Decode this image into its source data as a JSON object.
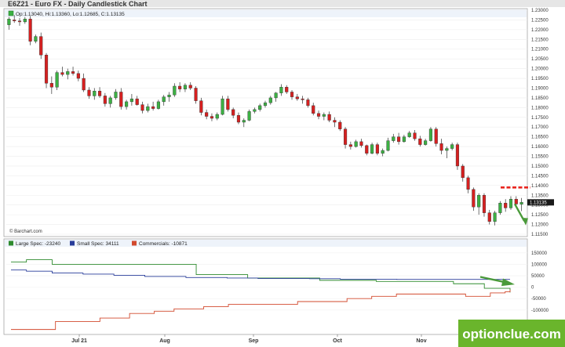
{
  "chart_data": [
    {
      "type": "candlestick",
      "title": "E6Z21 - Euro FX - Daily Candlestick Chart",
      "ohlc_label": "Op:1.13040, Hi:1.13360, Lo:1.12685, C:1.13135",
      "last_price_badge": "1.13135",
      "credit": "© Barchart.com",
      "y_ticks": [
        "1.23000",
        "1.22500",
        "1.22000",
        "1.21500",
        "1.21000",
        "1.20500",
        "1.20000",
        "1.19500",
        "1.19000",
        "1.18500",
        "1.18000",
        "1.17500",
        "1.17000",
        "1.16500",
        "1.16000",
        "1.15500",
        "1.15000",
        "1.14500",
        "1.14000",
        "1.13500",
        "1.13000",
        "1.12500",
        "1.12000",
        "1.11500"
      ],
      "ylim": [
        1.115,
        1.23
      ],
      "x_tick_labels": [
        "Jul 21",
        "Aug",
        "Sep",
        "Oct",
        "Nov"
      ],
      "annotations": {
        "support_level": 1.139,
        "support_color": "#e8251f",
        "arrow_color": "#4a9a3a"
      },
      "colors": {
        "up": "#3cb043",
        "down": "#d62020"
      },
      "candles": [
        [
          1.2225,
          1.2265,
          1.22,
          1.2255
        ],
        [
          1.225,
          1.2275,
          1.2235,
          1.2245
        ],
        [
          1.2245,
          1.226,
          1.222,
          1.224
        ],
        [
          1.224,
          1.2265,
          1.223,
          1.2255
        ],
        [
          1.2255,
          1.227,
          1.212,
          1.214
        ],
        [
          1.214,
          1.2175,
          1.213,
          1.2165
        ],
        [
          1.2165,
          1.2185,
          1.205,
          1.207
        ],
        [
          1.207,
          1.208,
          1.19,
          1.1925
        ],
        [
          1.1925,
          1.196,
          1.187,
          1.1905
        ],
        [
          1.1905,
          1.199,
          1.189,
          1.198
        ],
        [
          1.198,
          1.201,
          1.196,
          1.197
        ],
        [
          1.197,
          1.2,
          1.1945,
          1.1985
        ],
        [
          1.1985,
          1.201,
          1.1965,
          1.1975
        ],
        [
          1.1975,
          1.199,
          1.1935,
          1.195
        ],
        [
          1.195,
          1.1975,
          1.188,
          1.189
        ],
        [
          1.189,
          1.1905,
          1.1845,
          1.186
        ],
        [
          1.186,
          1.19,
          1.184,
          1.1885
        ],
        [
          1.1885,
          1.1905,
          1.185,
          1.186
        ],
        [
          1.186,
          1.1875,
          1.1805,
          1.182
        ],
        [
          1.182,
          1.186,
          1.18,
          1.185
        ],
        [
          1.185,
          1.1895,
          1.184,
          1.188
        ],
        [
          1.188,
          1.19,
          1.179,
          1.1805
        ],
        [
          1.1805,
          1.184,
          1.179,
          1.183
        ],
        [
          1.183,
          1.187,
          1.181,
          1.1845
        ],
        [
          1.1845,
          1.186,
          1.181,
          1.1815
        ],
        [
          1.1815,
          1.183,
          1.177,
          1.1785
        ],
        [
          1.1785,
          1.182,
          1.1775,
          1.1805
        ],
        [
          1.1805,
          1.183,
          1.1785,
          1.1795
        ],
        [
          1.1795,
          1.184,
          1.179,
          1.183
        ],
        [
          1.183,
          1.1865,
          1.181,
          1.1855
        ],
        [
          1.1855,
          1.188,
          1.183,
          1.1865
        ],
        [
          1.1865,
          1.1925,
          1.1855,
          1.191
        ],
        [
          1.191,
          1.193,
          1.188,
          1.1895
        ],
        [
          1.1895,
          1.1925,
          1.188,
          1.1915
        ],
        [
          1.1915,
          1.193,
          1.189,
          1.19
        ],
        [
          1.19,
          1.191,
          1.182,
          1.1835
        ],
        [
          1.1835,
          1.185,
          1.176,
          1.1775
        ],
        [
          1.1775,
          1.179,
          1.174,
          1.1755
        ],
        [
          1.1755,
          1.177,
          1.173,
          1.1745
        ],
        [
          1.1745,
          1.1775,
          1.1735,
          1.1765
        ],
        [
          1.1765,
          1.186,
          1.176,
          1.1845
        ],
        [
          1.1845,
          1.186,
          1.178,
          1.179
        ],
        [
          1.179,
          1.18,
          1.1745,
          1.176
        ],
        [
          1.176,
          1.1775,
          1.1715,
          1.1725
        ],
        [
          1.1725,
          1.1745,
          1.17,
          1.1735
        ],
        [
          1.1735,
          1.179,
          1.173,
          1.178
        ],
        [
          1.178,
          1.18,
          1.177,
          1.179
        ],
        [
          1.179,
          1.182,
          1.178,
          1.181
        ],
        [
          1.181,
          1.1835,
          1.18,
          1.1825
        ],
        [
          1.1825,
          1.186,
          1.1815,
          1.185
        ],
        [
          1.185,
          1.188,
          1.183,
          1.1875
        ],
        [
          1.1875,
          1.192,
          1.186,
          1.1905
        ],
        [
          1.1905,
          1.1915,
          1.187,
          1.188
        ],
        [
          1.188,
          1.189,
          1.184,
          1.1855
        ],
        [
          1.1855,
          1.187,
          1.1835,
          1.1845
        ],
        [
          1.1845,
          1.186,
          1.182,
          1.184
        ],
        [
          1.184,
          1.185,
          1.18,
          1.181
        ],
        [
          1.181,
          1.1825,
          1.176,
          1.177
        ],
        [
          1.177,
          1.1785,
          1.174,
          1.1755
        ],
        [
          1.1755,
          1.1775,
          1.1735,
          1.1765
        ],
        [
          1.1765,
          1.178,
          1.1725,
          1.1735
        ],
        [
          1.1735,
          1.175,
          1.17,
          1.1725
        ],
        [
          1.1725,
          1.1735,
          1.168,
          1.169
        ],
        [
          1.169,
          1.17,
          1.159,
          1.161
        ],
        [
          1.161,
          1.1625,
          1.1585,
          1.16
        ],
        [
          1.16,
          1.1635,
          1.1595,
          1.1625
        ],
        [
          1.1625,
          1.164,
          1.1595,
          1.1605
        ],
        [
          1.1605,
          1.161,
          1.1555,
          1.1565
        ],
        [
          1.1565,
          1.162,
          1.156,
          1.161
        ],
        [
          1.161,
          1.162,
          1.1555,
          1.1565
        ],
        [
          1.1565,
          1.159,
          1.155,
          1.158
        ],
        [
          1.158,
          1.1645,
          1.1575,
          1.163
        ],
        [
          1.163,
          1.1665,
          1.162,
          1.165
        ],
        [
          1.165,
          1.167,
          1.161,
          1.1625
        ],
        [
          1.1625,
          1.166,
          1.162,
          1.165
        ],
        [
          1.165,
          1.168,
          1.1645,
          1.167
        ],
        [
          1.167,
          1.1685,
          1.163,
          1.164
        ],
        [
          1.164,
          1.1655,
          1.16,
          1.161
        ],
        [
          1.161,
          1.164,
          1.1605,
          1.163
        ],
        [
          1.163,
          1.17,
          1.1625,
          1.169
        ],
        [
          1.169,
          1.17,
          1.16,
          1.1615
        ],
        [
          1.1615,
          1.164,
          1.156,
          1.158
        ],
        [
          1.158,
          1.16,
          1.154,
          1.159
        ],
        [
          1.159,
          1.162,
          1.158,
          1.161
        ],
        [
          1.161,
          1.162,
          1.148,
          1.15
        ],
        [
          1.15,
          1.151,
          1.142,
          1.144
        ],
        [
          1.144,
          1.145,
          1.136,
          1.138
        ],
        [
          1.138,
          1.139,
          1.127,
          1.129
        ],
        [
          1.129,
          1.136,
          1.125,
          1.135
        ],
        [
          1.135,
          1.136,
          1.124,
          1.126
        ],
        [
          1.126,
          1.1275,
          1.12,
          1.1215
        ],
        [
          1.1215,
          1.127,
          1.1195,
          1.126
        ],
        [
          1.126,
          1.132,
          1.125,
          1.131
        ],
        [
          1.131,
          1.133,
          1.1265,
          1.1285
        ],
        [
          1.1285,
          1.1345,
          1.1275,
          1.133
        ],
        [
          1.133,
          1.1345,
          1.129,
          1.1305
        ],
        [
          1.1304,
          1.1336,
          1.12685,
          1.13135
        ]
      ],
      "lower_panel": {
        "type": "line",
        "y_ticks": [
          "150000",
          "100000",
          "50000",
          "0",
          "-50000",
          "-100000"
        ],
        "ylim": [
          -200000,
          170000
        ],
        "series": [
          {
            "name": "Large Spec: -23240",
            "color": "#2e8b2e",
            "values": [
              110000,
              110000,
              110000,
              120000,
              120000,
              120000,
              120000,
              120000,
              100000,
              100000,
              100000,
              100000,
              100000,
              100000,
              100000,
              100000,
              100000,
              100000,
              100000,
              100000,
              100000,
              100000,
              100000,
              100000,
              100000,
              100000,
              100000,
              100000,
              100000,
              100000,
              100000,
              100000,
              100000,
              100000,
              100000,
              100000,
              55000,
              55000,
              55000,
              55000,
              55000,
              55000,
              55000,
              55000,
              55000,
              55000,
              40000,
              40000,
              40000,
              40000,
              40000,
              40000,
              40000,
              40000,
              40000,
              40000,
              40000,
              40000,
              40000,
              40000,
              30000,
              30000,
              30000,
              30000,
              30000,
              30000,
              30000,
              30000,
              30000,
              30000,
              30000,
              25000,
              25000,
              25000,
              25000,
              25000,
              25000,
              25000,
              25000,
              25000,
              25000,
              25000,
              25000,
              25000,
              25000,
              25000,
              15000,
              15000,
              15000,
              15000,
              15000,
              15000,
              -5000,
              -5000,
              -5000,
              -5000,
              -5000,
              -23240
            ]
          },
          {
            "name": "Small Spec: 34111",
            "color": "#283c9a",
            "values": [
              75000,
              75000,
              75000,
              70000,
              70000,
              70000,
              70000,
              70000,
              62000,
              62000,
              62000,
              62000,
              62000,
              62000,
              57000,
              57000,
              57000,
              57000,
              57000,
              57000,
              52000,
              52000,
              52000,
              52000,
              52000,
              52000,
              47000,
              47000,
              47000,
              47000,
              47000,
              47000,
              47000,
              47000,
              42000,
              42000,
              42000,
              42000,
              42000,
              42000,
              42000,
              42000,
              40000,
              40000,
              40000,
              40000,
              40000,
              40000,
              38000,
              38000,
              38000,
              38000,
              38000,
              38000,
              38000,
              38000,
              38000,
              38000,
              37000,
              37000,
              37000,
              37000,
              37000,
              37000,
              35000,
              35000,
              35000,
              35000,
              35000,
              35000,
              35000,
              35000,
              35000,
              35000,
              35000,
              34000,
              34000,
              34000,
              34000,
              34000,
              34000,
              34000,
              34000,
              34000,
              34000,
              34000,
              34000,
              34000,
              34000,
              34000,
              34000,
              34000,
              34000,
              34000,
              34000,
              34111,
              34111,
              34111
            ]
          },
          {
            "name": "Commercials: -10871",
            "color": "#d24a2e",
            "values": [
              -185000,
              -185000,
              -185000,
              -185000,
              -185000,
              -185000,
              -185000,
              -185000,
              -185000,
              -150000,
              -150000,
              -150000,
              -150000,
              -150000,
              -150000,
              -150000,
              -150000,
              -150000,
              -135000,
              -135000,
              -135000,
              -135000,
              -135000,
              -135000,
              -115000,
              -115000,
              -115000,
              -115000,
              -115000,
              -105000,
              -105000,
              -105000,
              -105000,
              -95000,
              -95000,
              -95000,
              -95000,
              -95000,
              -95000,
              -85000,
              -85000,
              -85000,
              -85000,
              -85000,
              -75000,
              -75000,
              -75000,
              -75000,
              -75000,
              -75000,
              -75000,
              -75000,
              -75000,
              -75000,
              -75000,
              -75000,
              -75000,
              -75000,
              -63000,
              -63000,
              -63000,
              -63000,
              -63000,
              -63000,
              -63000,
              -63000,
              -63000,
              -63000,
              -50000,
              -50000,
              -50000,
              -50000,
              -50000,
              -40000,
              -40000,
              -40000,
              -40000,
              -40000,
              -30000,
              -30000,
              -30000,
              -30000,
              -30000,
              -30000,
              -30000,
              -30000,
              -30000,
              -30000,
              -30000,
              -30000,
              -30000,
              -30000,
              -40000,
              -40000,
              -40000,
              -40000,
              -40000,
              -25000,
              -25000,
              -25000,
              -20000,
              -10871
            ]
          }
        ]
      }
    }
  ],
  "watermark": {
    "text": "optionclue.com",
    "bg": "#6ab52c"
  }
}
